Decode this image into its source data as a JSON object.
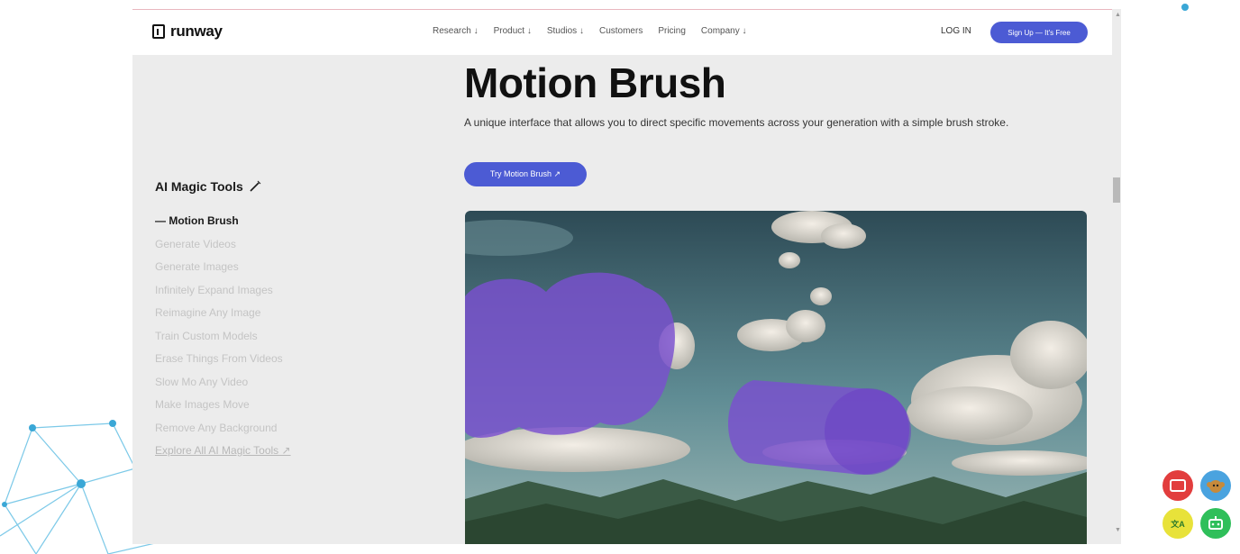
{
  "nav": {
    "logo": "runway",
    "links": [
      "Research ↓",
      "Product ↓",
      "Studios ↓",
      "Customers",
      "Pricing",
      "Company ↓"
    ],
    "login": "LOG IN",
    "signup": "Sign Up — It's Free"
  },
  "hero": {
    "title": "Motion Brush",
    "description": "A unique interface that allows you to direct specific movements across your generation with a simple brush stroke.",
    "cta": "Try Motion Brush ↗"
  },
  "sidebar": {
    "title": "AI Magic Tools",
    "title_icon": "magic-wand-icon",
    "active_prefix": "—",
    "items": [
      "Motion Brush",
      "Generate Videos",
      "Generate Images",
      "Infinitely Expand Images",
      "Reimagine Any Image",
      "Train Custom Models",
      "Erase Things From Videos",
      "Slow Mo Any Video",
      "Make Images Move",
      "Remove Any Background",
      "Explore All AI Magic Tools ↗"
    ]
  },
  "colors": {
    "accent": "#4c5bd4",
    "brush": "#7a4fd0",
    "page_bg": "#ececec"
  },
  "extensions": {
    "icons": [
      "video-extension-icon",
      "monkey-extension-icon",
      "translate-extension-icon",
      "robot-extension-icon"
    ],
    "translate_label": "文A"
  }
}
